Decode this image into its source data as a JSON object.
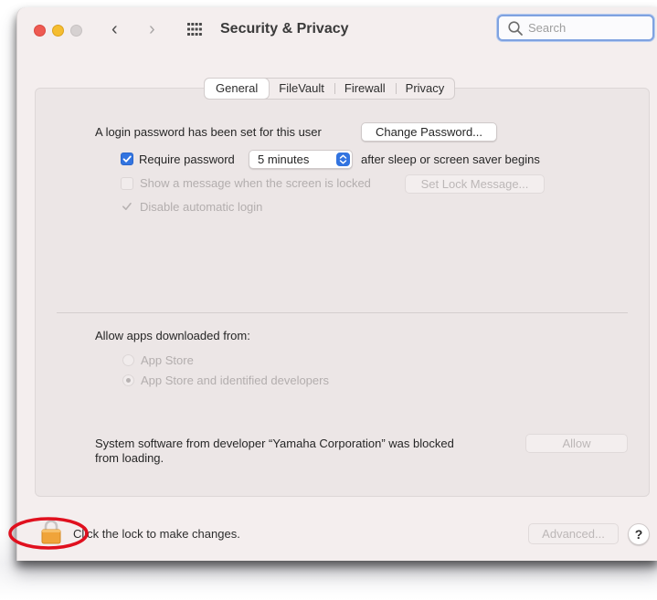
{
  "window": {
    "title": "Security & Privacy",
    "back_label": "‹",
    "forward_label": "›"
  },
  "search": {
    "placeholder": "Search",
    "value": ""
  },
  "tabs": [
    {
      "label": "General",
      "active": true
    },
    {
      "label": "FileVault",
      "active": false
    },
    {
      "label": "Firewall",
      "active": false
    },
    {
      "label": "Privacy",
      "active": false
    }
  ],
  "general": {
    "login_password_text": "A login password has been set for this user",
    "change_password_label": "Change Password...",
    "require_password": {
      "label": "Require password",
      "checked": true,
      "delay_value": "5 minutes",
      "suffix": "after sleep or screen saver begins"
    },
    "show_message": {
      "label": "Show a message when the screen is locked",
      "checked": false,
      "enabled": false,
      "button_label": "Set Lock Message..."
    },
    "disable_auto_login": {
      "label": "Disable automatic login",
      "checked": true,
      "enabled": false
    }
  },
  "apps": {
    "heading": "Allow apps downloaded from:",
    "options": [
      {
        "label": "App Store",
        "selected": false
      },
      {
        "label": "App Store and identified developers",
        "selected": true
      }
    ]
  },
  "blocked": {
    "text_line1": "System software from developer “Yamaha Corporation” was blocked",
    "text_line2": "from loading.",
    "allow_label": "Allow"
  },
  "footer": {
    "lock_text": "Click the lock to make changes.",
    "advanced_label": "Advanced...",
    "help_label": "?"
  },
  "colors": {
    "accent": "#3274e0",
    "window_bg": "#f4eeee",
    "panel_bg": "#ece6e6",
    "annotation": "#e0101e",
    "lock": "#f0a43a"
  },
  "icons": {
    "grid": "grid-icon",
    "search": "search-icon",
    "lock": "lock-icon",
    "check": "checkmark-icon",
    "chevron": "chevron-updown-icon"
  }
}
